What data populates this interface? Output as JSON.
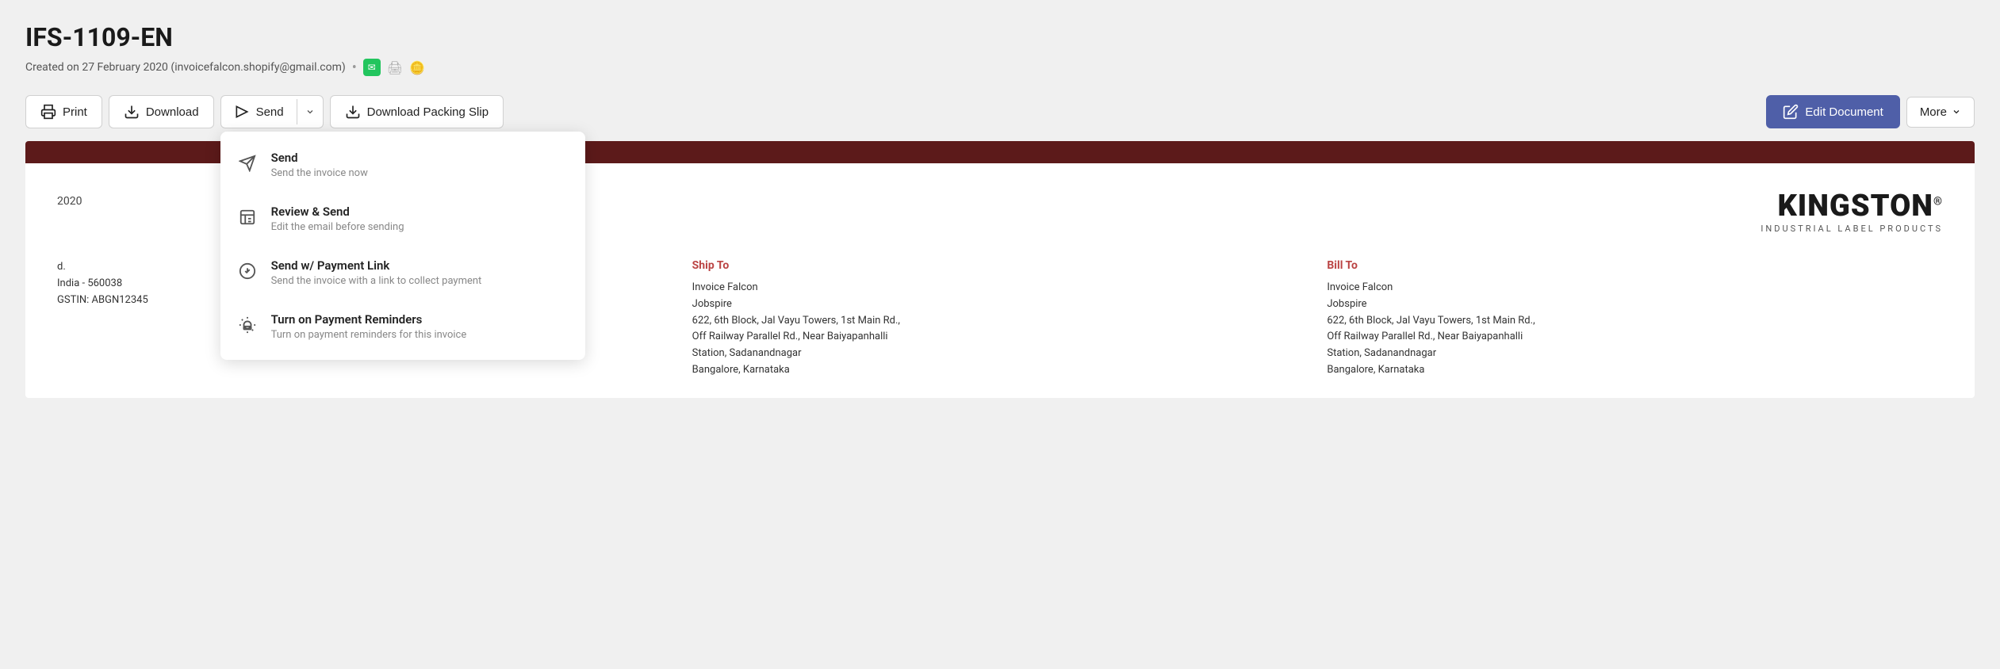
{
  "page": {
    "title": "IFS-1109-EN",
    "subtitle": "Created on 27 February 2020 (invoicefalcon.shopify@gmail.com)",
    "dot": "•"
  },
  "toolbar": {
    "print_label": "Print",
    "download_label": "Download",
    "send_label": "Send",
    "download_packing_slip_label": "Download Packing Slip",
    "edit_document_label": "Edit Document",
    "more_label": "More"
  },
  "send_dropdown": {
    "items": [
      {
        "title": "Send",
        "description": "Send the invoice now",
        "icon": "send-icon"
      },
      {
        "title": "Review & Send",
        "description": "Edit the email before sending",
        "icon": "review-send-icon"
      },
      {
        "title": "Send w/ Payment Link",
        "description": "Send the invoice with a link to collect payment",
        "icon": "payment-link-icon"
      },
      {
        "title": "Turn on Payment Reminders",
        "description": "Turn on payment reminders for this invoice",
        "icon": "reminders-icon"
      }
    ]
  },
  "invoice": {
    "date_label": "2020",
    "brand_name": "KINGSTON",
    "brand_reg": "®",
    "brand_sub": "INDUSTRIAL LABEL PRODUCTS",
    "ship_to_label": "Ship To",
    "bill_to_label": "Bill To",
    "ship_to": {
      "company": "Invoice Falcon",
      "sub": "Jobspire",
      "address1": "622, 6th Block, Jal Vayu Towers, 1st Main Rd.,",
      "address2": "Off Railway Parallel Rd., Near Baiyapanhalli",
      "address3": "Station, Sadanandnagar",
      "city": "Bangalore, Karnataka"
    },
    "bill_to": {
      "company": "Invoice Falcon",
      "sub": "Jobspire",
      "address1": "622, 6th Block, Jal Vayu Towers, 1st Main Rd.,",
      "address2": "Off Railway Parallel Rd., Near Baiyapanhalli",
      "address3": "Station, Sadanandnagar",
      "city": "Bangalore, Karnataka"
    },
    "left_address": {
      "line1": "d.",
      "line2": "India - 560038",
      "gstin": "GSTIN: ABGN12345"
    }
  },
  "colors": {
    "primary_btn": "#4f5fa8",
    "header_bar": "#5c1a1a",
    "ship_to_label": "#b44444",
    "bill_to_label": "#b44444"
  }
}
